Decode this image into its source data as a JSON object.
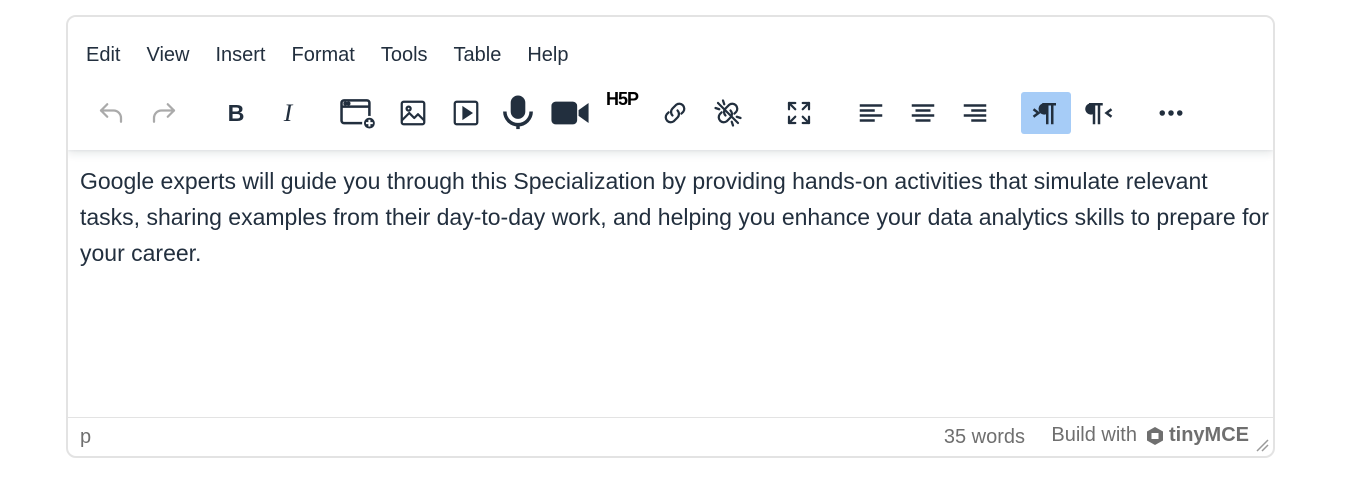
{
  "menubar": {
    "items": [
      "Edit",
      "View",
      "Insert",
      "Format",
      "Tools",
      "Table",
      "Help"
    ]
  },
  "toolbar": {
    "h5p_label": "H5P",
    "buttons": [
      {
        "name": "undo",
        "icon": "undo-icon",
        "state": "disabled"
      },
      {
        "name": "redo",
        "icon": "redo-icon",
        "state": "disabled"
      },
      {
        "name": "bold",
        "icon": "bold-icon",
        "state": "normal"
      },
      {
        "name": "italic",
        "icon": "italic-icon",
        "state": "normal"
      },
      {
        "name": "insert-embed",
        "icon": "embed-add-icon",
        "state": "normal"
      },
      {
        "name": "insert-image",
        "icon": "image-icon",
        "state": "normal"
      },
      {
        "name": "insert-media",
        "icon": "play-icon",
        "state": "normal"
      },
      {
        "name": "record-audio",
        "icon": "microphone-icon",
        "state": "normal"
      },
      {
        "name": "record-video",
        "icon": "video-camera-icon",
        "state": "normal"
      },
      {
        "name": "h5p",
        "icon": "h5p-icon",
        "state": "normal"
      },
      {
        "name": "link",
        "icon": "link-icon",
        "state": "normal"
      },
      {
        "name": "unlink",
        "icon": "unlink-icon",
        "state": "normal"
      },
      {
        "name": "fullscreen",
        "icon": "fullscreen-icon",
        "state": "normal"
      },
      {
        "name": "align-left",
        "icon": "align-left-icon",
        "state": "normal"
      },
      {
        "name": "align-center",
        "icon": "align-center-icon",
        "state": "normal"
      },
      {
        "name": "align-right",
        "icon": "align-right-icon",
        "state": "normal"
      },
      {
        "name": "ltr",
        "icon": "ltr-icon",
        "state": "active"
      },
      {
        "name": "rtl",
        "icon": "rtl-icon",
        "state": "normal"
      },
      {
        "name": "more",
        "icon": "more-icon",
        "state": "normal"
      }
    ]
  },
  "content": {
    "paragraph": "Google experts will guide you through this Specialization by providing hands-on activities that simulate relevant tasks, sharing examples from their day-to-day work, and helping you enhance your data analytics skills to prepare for your career."
  },
  "statusbar": {
    "path": "p",
    "word_count": "35 words",
    "branding_text": "Build with",
    "branding_name": "tinyMCE"
  },
  "colors": {
    "text": "#222f3e",
    "active_button": "#a6ccf7",
    "disabled_icon": "#aaaaaa",
    "border": "#e3e3e3",
    "status_text": "#6f6f6f"
  }
}
